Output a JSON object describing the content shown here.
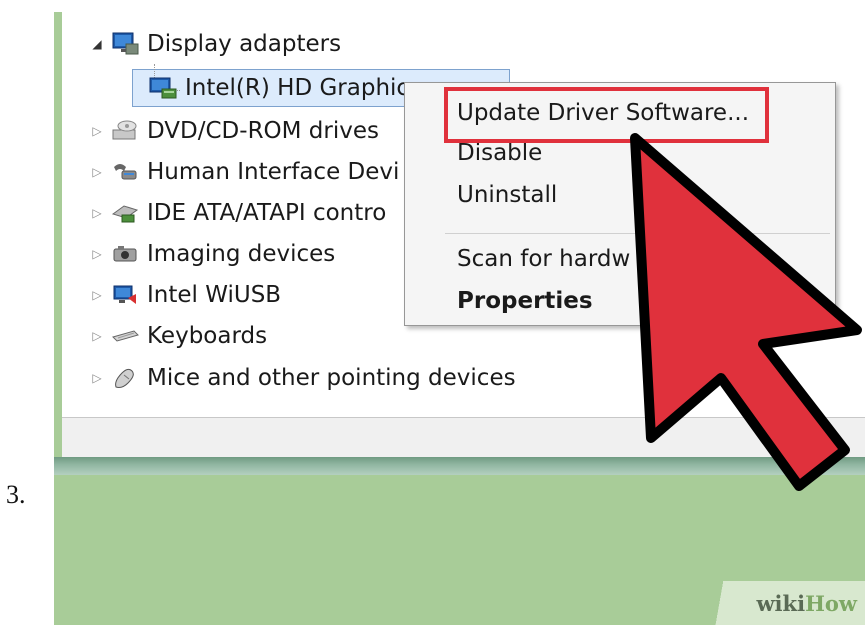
{
  "step_number": "3.",
  "device_tree": {
    "categories": [
      {
        "label": "Display adapters",
        "icon": "monitor-icon",
        "expanded": true
      },
      {
        "label": "DVD/CD-ROM drives",
        "icon": "dvd-drive-icon",
        "expanded": false
      },
      {
        "label": "Human Interface Devi",
        "icon": "hid-icon",
        "expanded": false
      },
      {
        "label": "IDE ATA/ATAPI contro",
        "icon": "ide-controller-icon",
        "expanded": false
      },
      {
        "label": "Imaging devices",
        "icon": "camera-icon",
        "expanded": false
      },
      {
        "label": "Intel WiUSB",
        "icon": "wireless-usb-icon",
        "expanded": false
      },
      {
        "label": "Keyboards",
        "icon": "keyboard-icon",
        "expanded": false
      },
      {
        "label": "Mice and other pointing devices",
        "icon": "mouse-icon",
        "expanded": false
      }
    ],
    "selected_device": {
      "label": "Intel(R) HD Graphic",
      "icon": "display-adapter-icon"
    }
  },
  "context_menu": {
    "items": [
      {
        "label": "Update Driver Software...",
        "bold": false
      },
      {
        "label": "Disable",
        "bold": false
      },
      {
        "label": "Uninstall",
        "bold": false
      },
      {
        "label": "Scan for hardw",
        "bold": false
      },
      {
        "label": "Properties",
        "bold": true
      }
    ]
  },
  "watermark": {
    "wiki": "wiki",
    "how": "How"
  },
  "colors": {
    "highlight_red": "#e0313c",
    "cursor_red": "#e0313c",
    "background_green": "#a8cc98"
  }
}
